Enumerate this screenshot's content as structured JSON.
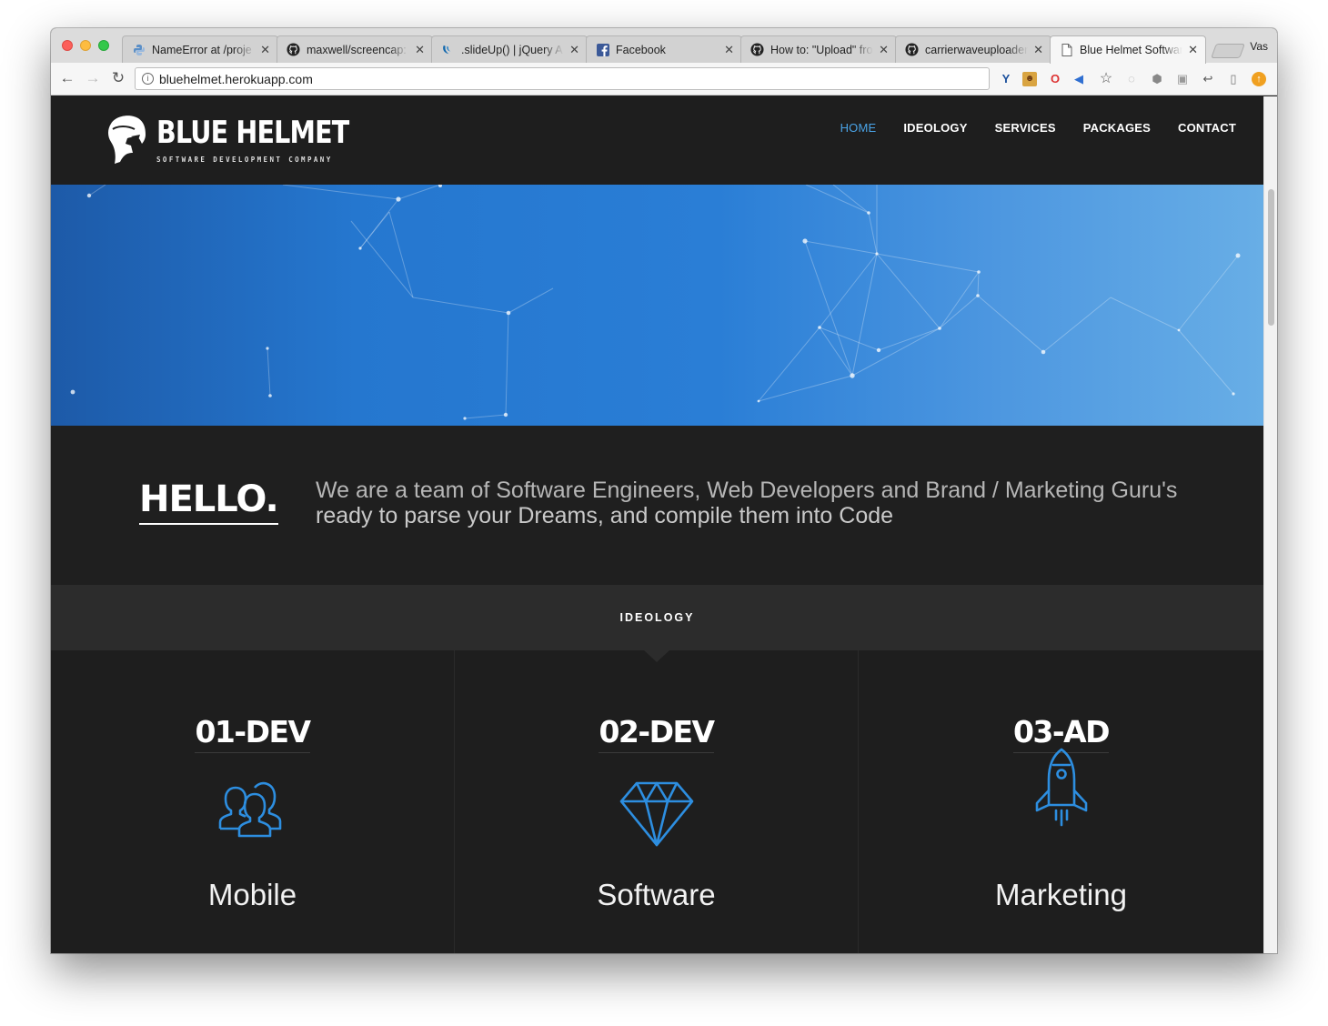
{
  "browser": {
    "tabs": [
      {
        "title": "NameError at /proje",
        "icon": "python-icon"
      },
      {
        "title": "maxwell/screencap:",
        "icon": "github-icon"
      },
      {
        "title": ".slideUp() | jQuery A",
        "icon": "jquery-icon"
      },
      {
        "title": "Facebook",
        "icon": "facebook-icon"
      },
      {
        "title": "How to: \"Upload\" fro",
        "icon": "github-icon"
      },
      {
        "title": "carrierwaveuploader",
        "icon": "github-icon"
      },
      {
        "title": "Blue Helmet Softwar",
        "icon": "page-icon"
      }
    ],
    "profile_name": "Vas",
    "url": "bluehelmet.herokuapp.com"
  },
  "site": {
    "logo_text": "BLUE HELMET",
    "logo_subtitle": "SOFTWARE DEVELOPMENT COMPANY",
    "nav": [
      "HOME",
      "IDEOLOGY",
      "SERVICES",
      "PACKAGES",
      "CONTACT"
    ],
    "active_nav": "HOME",
    "accent_color": "#4aa3e6"
  },
  "hello": {
    "heading": "HELLO.",
    "line1": "We are a team of Software Engineers, Web Developers and Brand / Marketing Guru's",
    "line2": "ready to parse your Dreams, and compile them into Code"
  },
  "ideology": {
    "title": "IDEOLOGY",
    "columns": [
      {
        "number": "01-DEV",
        "label": "Mobile",
        "icon": "users-icon"
      },
      {
        "number": "02-DEV",
        "label": "Software",
        "icon": "diamond-icon"
      },
      {
        "number": "03-AD",
        "label": "Marketing",
        "icon": "rocket-icon"
      }
    ]
  }
}
